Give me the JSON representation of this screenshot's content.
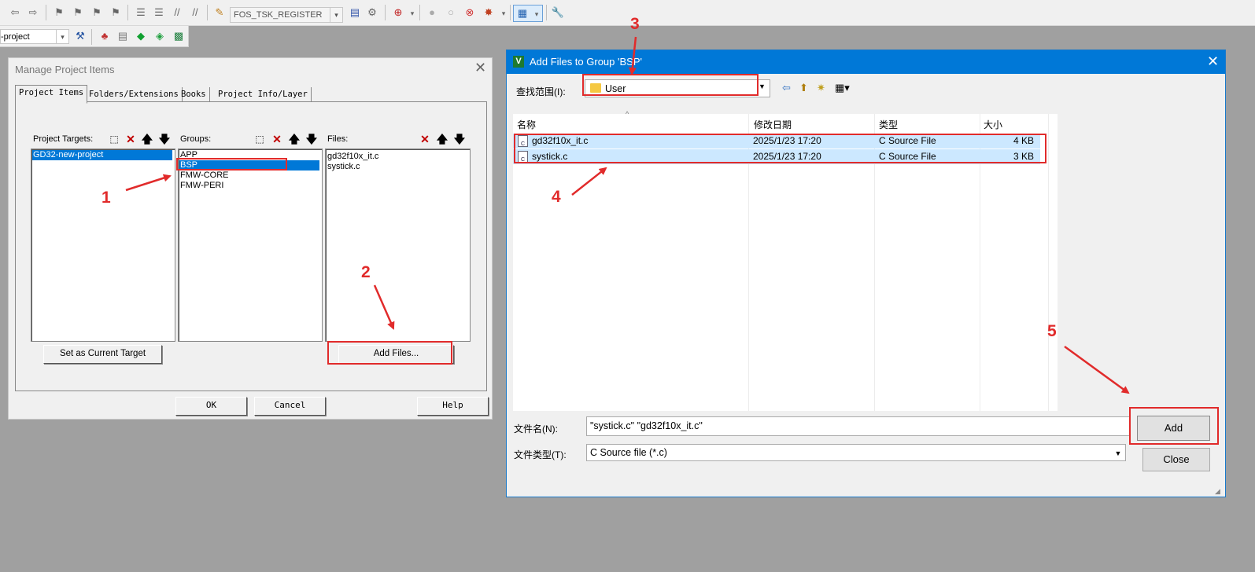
{
  "toolbar": {
    "task_combo": "FOS_TSK_REGISTER",
    "target_combo": "-project"
  },
  "manage_dialog": {
    "title": "Manage Project Items",
    "tabs": [
      "Project Items",
      "Folders/Extensions",
      "Books",
      "Project Info/Layer"
    ],
    "targets_label": "Project Targets:",
    "groups_label": "Groups:",
    "files_label": "Files:",
    "targets": [
      "GD32-new-project"
    ],
    "groups": [
      "APP",
      "BSP",
      "FMW-CORE",
      "FMW-PERI"
    ],
    "files": [
      "gd32f10x_it.c",
      "systick.c"
    ],
    "set_current_button": "Set as Current Target",
    "add_files_button": "Add Files...",
    "ok_button": "OK",
    "cancel_button": "Cancel",
    "help_button": "Help"
  },
  "add_dialog": {
    "title": "Add Files to Group 'BSP'",
    "look_in_label": "查找范围(I):",
    "look_in_value": "User",
    "columns": [
      "名称",
      "修改日期",
      "类型",
      "大小"
    ],
    "rows": [
      {
        "name": "gd32f10x_it.c",
        "date": "2025/1/23 17:20",
        "type": "C Source File",
        "size": "4 KB"
      },
      {
        "name": "systick.c",
        "date": "2025/1/23 17:20",
        "type": "C Source File",
        "size": "3 KB"
      }
    ],
    "filename_label": "文件名(N):",
    "filename_value": "\"systick.c\" \"gd32f10x_it.c\"",
    "filetype_label": "文件类型(T):",
    "filetype_value": "C Source file (*.c)",
    "add_button": "Add",
    "close_button": "Close"
  },
  "annotations": [
    "1",
    "2",
    "3",
    "4",
    "5"
  ],
  "colors": {
    "annotation": "#e12b2b",
    "selection": "#0078d7",
    "titlebar": "#0078d7"
  }
}
